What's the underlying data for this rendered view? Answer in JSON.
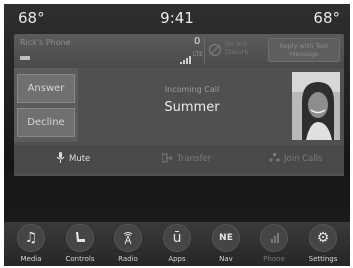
{
  "status": {
    "temp_left": "68°",
    "time": "9:41",
    "temp_right": "68°"
  },
  "phone_bar": {
    "device_name": "Rick's Phone",
    "signal_count": "0",
    "network": "LTE",
    "do_not_disturb": "Do Not Disturb",
    "reply_label": "Reply with Text Message"
  },
  "call": {
    "answer_label": "Answer",
    "decline_label": "Decline",
    "status_label": "Incoming Call",
    "caller_name": "Summer",
    "actions": [
      {
        "label": "Mute",
        "icon": "microphone-mute-icon",
        "enabled": true
      },
      {
        "label": "Transfer",
        "icon": "transfer-icon",
        "enabled": false
      },
      {
        "label": "Join Calls",
        "icon": "join-calls-icon",
        "enabled": false
      }
    ]
  },
  "nav": [
    {
      "label": "Media",
      "icon": "music-note-icon",
      "glyph": "♫",
      "enabled": true
    },
    {
      "label": "Controls",
      "icon": "seat-icon",
      "glyph": "",
      "enabled": true
    },
    {
      "label": "Radio",
      "icon": "radio-tower-icon",
      "glyph": "",
      "enabled": true
    },
    {
      "label": "Apps",
      "icon": "apps-icon",
      "glyph": "ū",
      "enabled": true
    },
    {
      "label": "Nav",
      "icon": "compass-icon",
      "glyph": "NE",
      "enabled": true
    },
    {
      "label": "Phone",
      "icon": "phone-icon",
      "glyph": "",
      "enabled": false
    },
    {
      "label": "Settings",
      "icon": "gear-icon",
      "glyph": "⚙",
      "enabled": true
    }
  ]
}
